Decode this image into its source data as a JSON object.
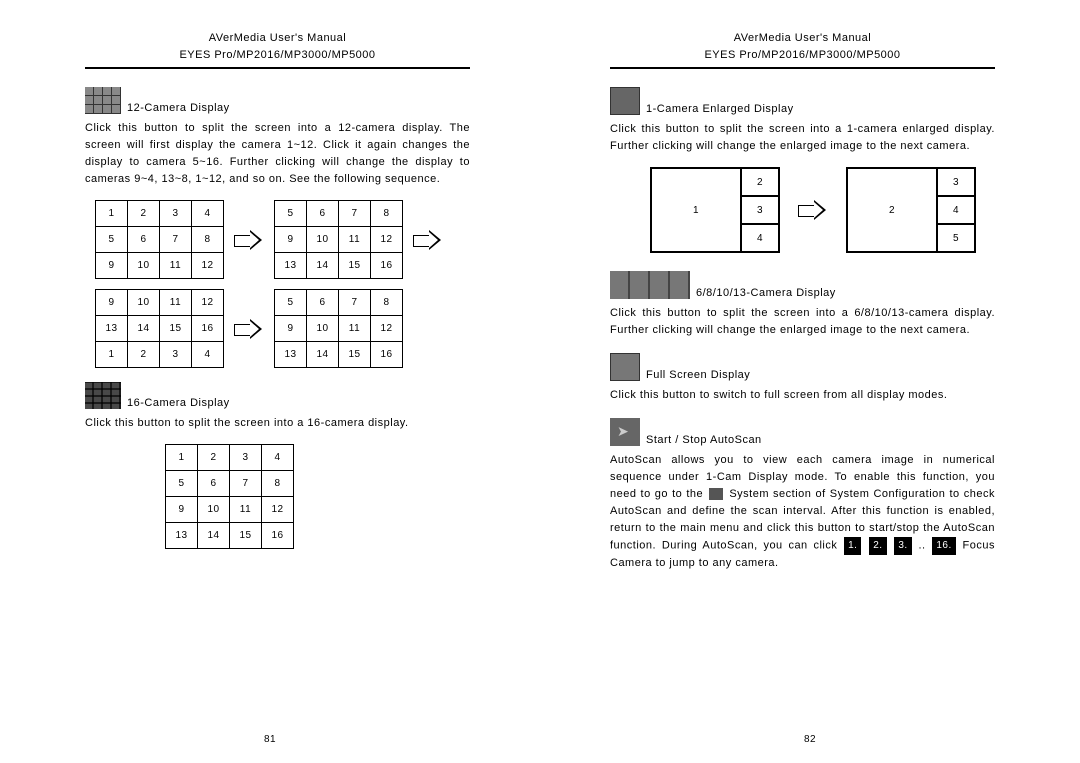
{
  "header": {
    "title": "AVerMedia User's Manual",
    "subtitle": "EYES Pro/MP2016/MP3000/MP5000"
  },
  "left": {
    "s12": {
      "label": "12-Camera Display",
      "para": "Click this button to split the screen into a 12-camera display.  The screen will first display the camera 1~12.  Click it again changes the display to camera 5~16.  Further clicking will change the display to cameras 9~4, 13~8, 1~12, and so on.  See the following sequence."
    },
    "grids12": {
      "a": [
        "1",
        "2",
        "3",
        "4",
        "5",
        "6",
        "7",
        "8",
        "9",
        "10",
        "11",
        "12"
      ],
      "b": [
        "5",
        "6",
        "7",
        "8",
        "9",
        "10",
        "11",
        "12",
        "13",
        "14",
        "15",
        "16"
      ],
      "c": [
        "9",
        "10",
        "11",
        "12",
        "13",
        "14",
        "15",
        "16",
        "1",
        "2",
        "3",
        "4"
      ],
      "d": [
        "5",
        "6",
        "7",
        "8",
        "9",
        "10",
        "11",
        "12",
        "13",
        "14",
        "15",
        "16"
      ]
    },
    "s16": {
      "label": "16-Camera Display",
      "para": "Click this button to split the screen into a 16-camera display."
    },
    "grid16": [
      "1",
      "2",
      "3",
      "4",
      "5",
      "6",
      "7",
      "8",
      "9",
      "10",
      "11",
      "12",
      "13",
      "14",
      "15",
      "16"
    ],
    "pagenum": "81"
  },
  "right": {
    "s1": {
      "label": "1-Camera Enlarged Display",
      "para": "Click this button to split the screen into a 1-camera enlarged display. Further clicking will change the enlarged image to the next camera."
    },
    "enlA": {
      "big": "1",
      "cells": [
        "2",
        "3",
        "4"
      ]
    },
    "enlB": {
      "big": "2",
      "cells": [
        "3",
        "4",
        "5"
      ]
    },
    "sMulti": {
      "label": "6/8/10/13-Camera Display",
      "para": "Click this button to split the screen into a 6/8/10/13-camera display. Further clicking will change the enlarged image to the next camera."
    },
    "sFull": {
      "label": "Full Screen Display",
      "para": "Click this button to switch to full screen from all display modes."
    },
    "sAuto": {
      "label": "Start / Stop AutoScan",
      "para1": "AutoScan allows you to view each camera image in numerical sequence under 1-Cam Display mode.  To enable this function, you need to go to",
      "para2a": "the",
      "para2b": "System section of System Configuration to check AutoScan and define the scan interval.  After this function is enabled, return to the main menu and click this button to start/stop the AutoScan function.",
      "para3a": "During AutoScan, you can click",
      "btns": [
        "1.",
        "2.",
        "3.",
        "16."
      ],
      "dots": "..",
      "para3b": "Focus Camera to jump to any camera."
    },
    "pagenum": "82"
  }
}
